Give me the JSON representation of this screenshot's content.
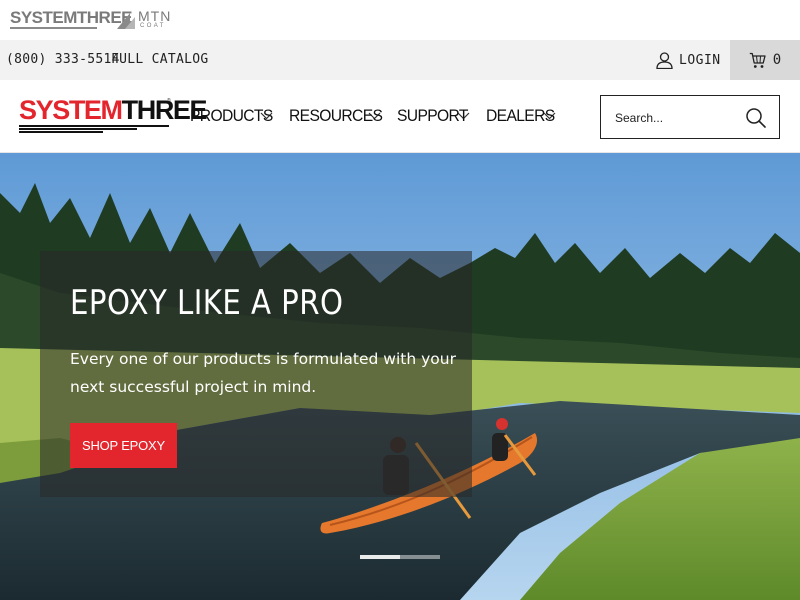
{
  "brands": {
    "systemthree": "SYSTEMTHREE",
    "mtn": "MTN",
    "mtn_sub": "COAT"
  },
  "utility": {
    "phone": "(800) 333-5514",
    "catalog": "FULL CATALOG",
    "login": "LOGIN",
    "cart_count": "0",
    "icons": {
      "login": "user-icon",
      "cart": "shopping-cart-icon"
    }
  },
  "logo": {
    "part1": "SYSTEM",
    "part2": "THREE",
    "tm": "®"
  },
  "nav": {
    "items": [
      {
        "label": "PRODUCTS"
      },
      {
        "label": "RESOURCES"
      },
      {
        "label": "SUPPORT"
      },
      {
        "label": "DEALERS"
      }
    ]
  },
  "search": {
    "placeholder": "Search...",
    "icon": "search-icon"
  },
  "hero": {
    "headline": "EPOXY LIKE A PRO",
    "subtext": "Every one of our products is formulated with your next successful project in mind.",
    "cta": "SHOP EPOXY",
    "slides_total": 2,
    "active_slide": 1
  },
  "colors": {
    "brand_red": "#e3262e",
    "utility_bg": "#f2f2f2",
    "cart_bg": "#d9d9d9"
  }
}
